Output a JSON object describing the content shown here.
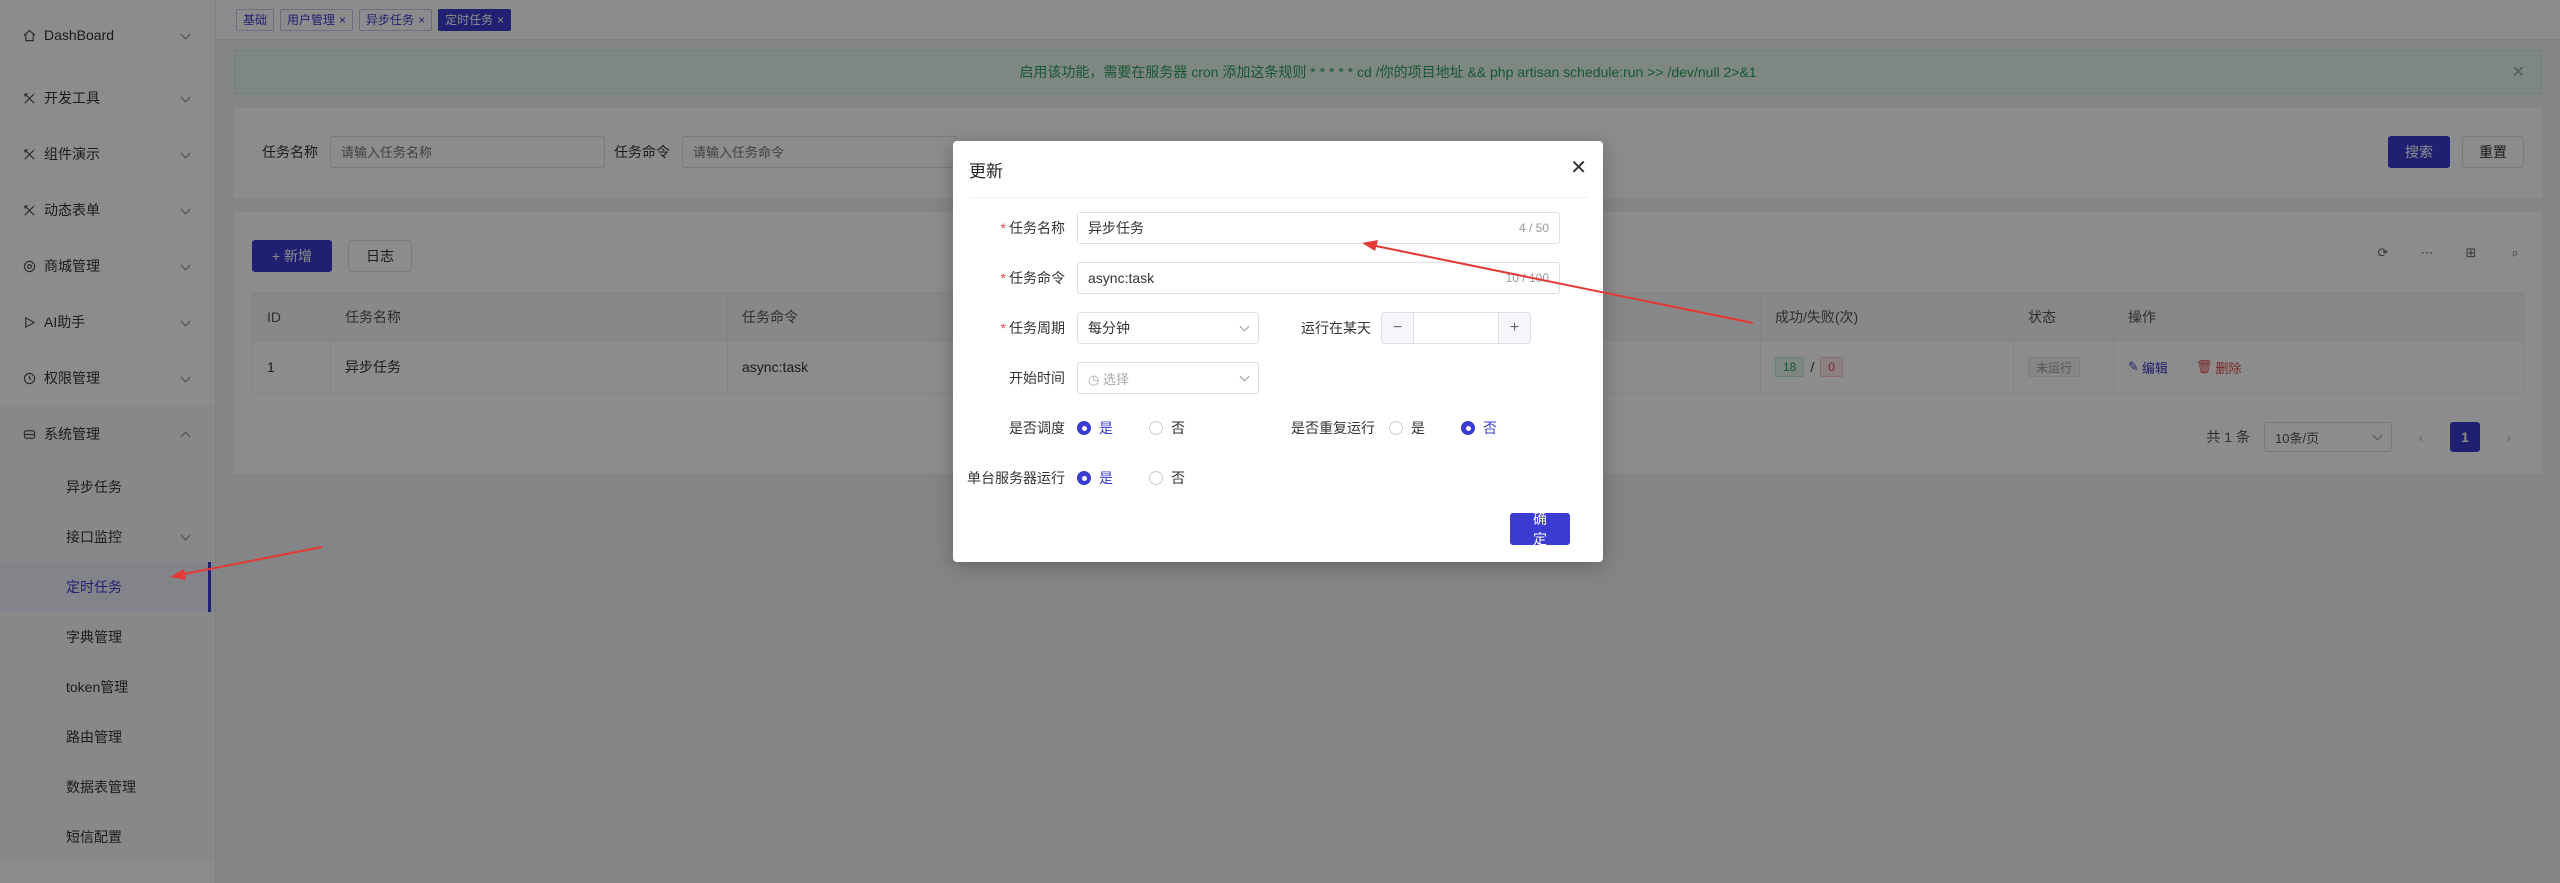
{
  "sidebar": {
    "items": [
      {
        "label": "DashBoard",
        "icon": "home-icon"
      },
      {
        "label": "开发工具",
        "icon": "tool-icon"
      },
      {
        "label": "组件演示",
        "icon": "tool-icon"
      },
      {
        "label": "动态表单",
        "icon": "tool-icon"
      },
      {
        "label": "商城管理",
        "icon": "shop-icon"
      },
      {
        "label": "AI助手",
        "icon": "play-icon"
      },
      {
        "label": "权限管理",
        "icon": "lock-icon"
      },
      {
        "label": "系统管理",
        "icon": "settings-icon"
      }
    ],
    "submenu": [
      {
        "label": "异步任务"
      },
      {
        "label": "接口监控"
      },
      {
        "label": "定时任务"
      },
      {
        "label": "字典管理"
      },
      {
        "label": "token管理"
      },
      {
        "label": "路由管理"
      },
      {
        "label": "数据表管理"
      },
      {
        "label": "短信配置"
      }
    ]
  },
  "tags": [
    {
      "label": "基础"
    },
    {
      "label": "用户管理"
    },
    {
      "label": "异步任务"
    },
    {
      "label": "定时任务"
    }
  ],
  "alert": {
    "text": "启用该功能，需要在服务器 cron 添加这条规则 * * * * * cd /你的项目地址 && php artisan schedule:run >> /dev/null 2>&1"
  },
  "search": {
    "name_label": "任务名称",
    "name_placeholder": "请输入任务名称",
    "cmd_label": "任务命令",
    "cmd_placeholder": "请输入任务命令",
    "search_button": "搜索",
    "reset_button": "重置"
  },
  "toolbar": {
    "add_button": "+ 新增",
    "log_button": "日志"
  },
  "table": {
    "headers": [
      "ID",
      "任务名称",
      "任务命令",
      "成功/失败(次)",
      "状态",
      "操作"
    ],
    "rows": [
      {
        "id": "1",
        "name": "异步任务",
        "cmd": "async:task",
        "success": "18",
        "sep": "/",
        "fail": "0",
        "status": "未运行",
        "edit": "编辑",
        "delete": "删除"
      }
    ]
  },
  "pager": {
    "total": "共 1 条",
    "page_size": "10条/页",
    "prev": "‹",
    "current": "1",
    "next": "›"
  },
  "modal": {
    "title": "更新",
    "name_label": "任务名称",
    "name_value": "异步任务",
    "name_count": "4 / 50",
    "cmd_label": "任务命令",
    "cmd_value": "async:task",
    "cmd_count": "10 / 100",
    "period_label": "任务周期",
    "period_value": "每分钟",
    "day_label": "运行在某天",
    "minus": "−",
    "plus": "+",
    "start_label": "开始时间",
    "start_placeholder": "选择",
    "schedule_label": "是否调度",
    "repeat_label": "是否重复运行",
    "single_label": "单台服务器运行",
    "yes": "是",
    "no": "否",
    "confirm": "确定"
  },
  "colors": {
    "primary": "#3b3bd0",
    "success": "#2aa05a",
    "danger": "#e04b4b",
    "annotation": "#e53935"
  }
}
